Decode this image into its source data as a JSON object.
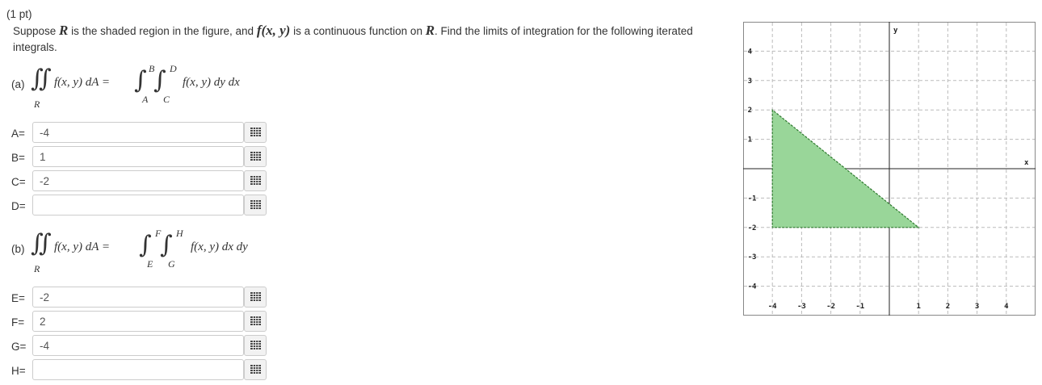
{
  "problem": {
    "points": "(1 pt)",
    "statement_pre": "Suppose ",
    "region_var": "R",
    "statement_mid": " is the shaded region in the figure, and ",
    "function_expr": "f(x, y)",
    "statement_mid2": " is a continuous function on ",
    "statement_post": ". Find the limits of integration for the following iterated integrals."
  },
  "part_a": {
    "tag": "(a)",
    "lhs_integrand": "f(x, y) dA =",
    "region_sub": "R",
    "outer_upper": "B",
    "outer_lower": "A",
    "inner_upper": "D",
    "inner_lower": "C",
    "rhs_integrand": "f(x, y) dy dx"
  },
  "part_b": {
    "tag": "(b)",
    "lhs_integrand": "f(x, y) dA =",
    "region_sub": "R",
    "outer_upper": "F",
    "outer_lower": "E",
    "inner_upper": "H",
    "inner_lower": "G",
    "rhs_integrand": "f(x, y) dx dy"
  },
  "answers_a": [
    {
      "label": "A=",
      "value": "-4"
    },
    {
      "label": "B=",
      "value": "1"
    },
    {
      "label": "C=",
      "value": "-2"
    },
    {
      "label": "D=",
      "value": ""
    }
  ],
  "answers_b": [
    {
      "label": "E=",
      "value": "-2"
    },
    {
      "label": "F=",
      "value": "2"
    },
    {
      "label": "G=",
      "value": "-4"
    },
    {
      "label": "H=",
      "value": ""
    }
  ],
  "graph": {
    "x_axis_label": "x",
    "y_axis_label": "y",
    "x_range": [
      -5,
      5
    ],
    "y_range": [
      -5,
      5
    ],
    "x_tick_labels": [
      "-4",
      "-3",
      "-2",
      "-1",
      "1",
      "2",
      "3",
      "4"
    ],
    "y_tick_labels": [
      "4",
      "3",
      "2",
      "1",
      "-1",
      "-2",
      "-3",
      "-4"
    ],
    "region_vertices": [
      [
        -4,
        2
      ],
      [
        -4,
        -2
      ],
      [
        1,
        -2
      ]
    ],
    "region_fill": "#99d699",
    "region_stroke": "#2f7a2f",
    "grid_color": "#bbbbbb"
  },
  "icons": {
    "palette_icon": "grid-palette-icon"
  }
}
